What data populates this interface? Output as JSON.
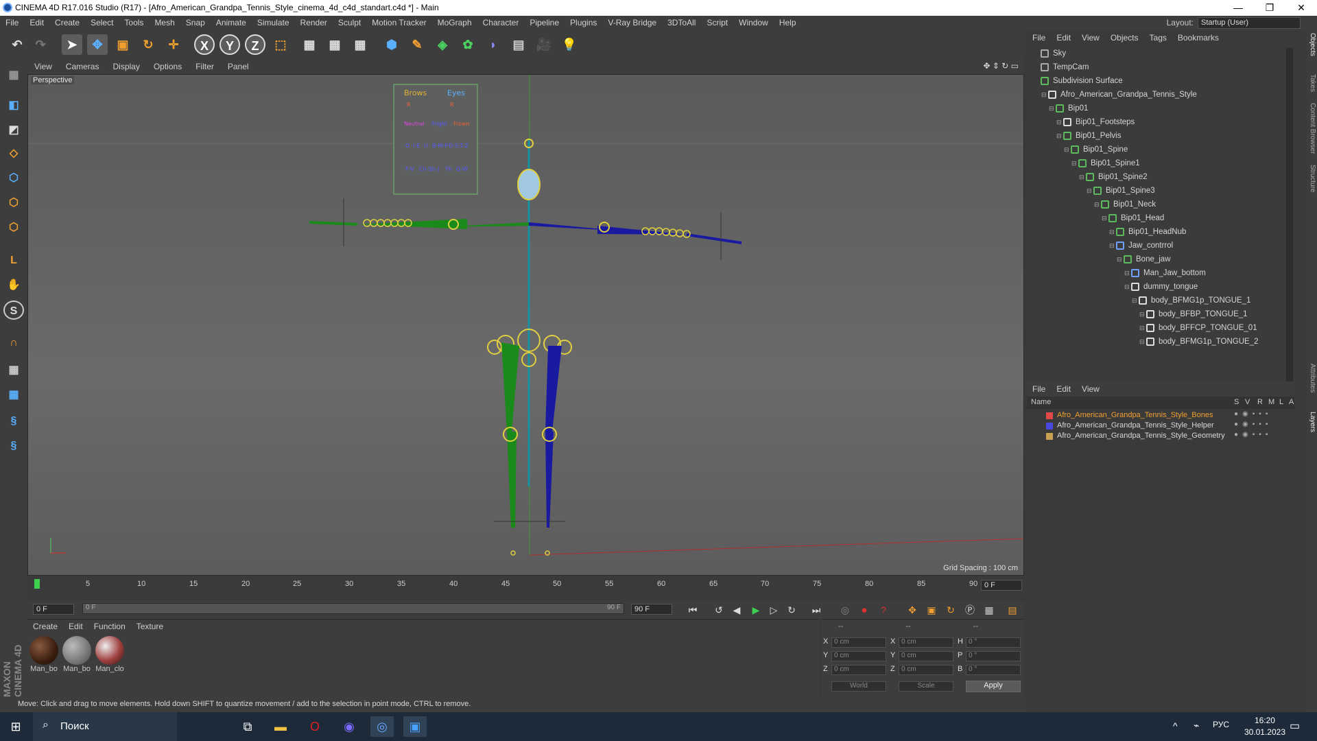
{
  "window": {
    "title": "CINEMA 4D R17.016 Studio (R17) - [Afro_American_Grandpa_Tennis_Style_cinema_4d_c4d_standart.c4d *] - Main"
  },
  "menubar": {
    "items": [
      "File",
      "Edit",
      "Create",
      "Select",
      "Tools",
      "Mesh",
      "Snap",
      "Animate",
      "Simulate",
      "Render",
      "Sculpt",
      "Motion Tracker",
      "MoGraph",
      "Character",
      "Pipeline",
      "Plugins",
      "V-Ray Bridge",
      "3DToAll",
      "Script",
      "Window",
      "Help"
    ],
    "layout_label": "Layout:",
    "layout_value": "Startup (User)"
  },
  "toolbar": {
    "axis": [
      "X",
      "Y",
      "Z"
    ]
  },
  "viewport": {
    "menu": [
      "View",
      "Cameras",
      "Display",
      "Options",
      "Filter",
      "Panel"
    ],
    "label": "Perspective",
    "grid_spacing": "Grid Spacing : 100 cm",
    "overlay_labels": [
      "Brows",
      "Eyes",
      "R",
      "R",
      "Neutral",
      "Fright",
      "Frown",
      "O",
      "I-E",
      "U",
      "B-M-P",
      "D-S-T-Z",
      "F-V",
      "Ch-Sh-J",
      "Th",
      "Q-W"
    ]
  },
  "timeline": {
    "ticks": [
      "0",
      "5",
      "10",
      "15",
      "20",
      "25",
      "30",
      "35",
      "40",
      "45",
      "50",
      "55",
      "60",
      "65",
      "70",
      "75",
      "80",
      "85",
      "90"
    ],
    "current_field": "0 F"
  },
  "playbar": {
    "start": "0 F",
    "slider_start": "0 F",
    "slider_end": "90 F",
    "end": "90 F"
  },
  "materials": {
    "menu": [
      "Create",
      "Edit",
      "Function",
      "Texture"
    ],
    "items": [
      {
        "label": "Man_bo"
      },
      {
        "label": "Man_bo"
      },
      {
        "label": "Man_clo"
      }
    ]
  },
  "coords": {
    "header": [
      "--",
      "--",
      "--"
    ],
    "rows": [
      {
        "l1": "X",
        "v1": "0 cm",
        "l2": "X",
        "v2": "0 cm",
        "l3": "H",
        "v3": "0 °"
      },
      {
        "l1": "Y",
        "v1": "0 cm",
        "l2": "Y",
        "v2": "0 cm",
        "l3": "P",
        "v3": "0 °"
      },
      {
        "l1": "Z",
        "v1": "0 cm",
        "l2": "Z",
        "v2": "0 cm",
        "l3": "B",
        "v3": "0 °"
      }
    ],
    "world": "World",
    "scale": "Scale",
    "apply": "Apply"
  },
  "status": {
    "text": "Move: Click and drag to move elements. Hold down SHIFT to quantize movement / add to the selection in point mode, CTRL to remove."
  },
  "objects": {
    "menu": [
      "File",
      "Edit",
      "View",
      "Objects",
      "Tags",
      "Bookmarks"
    ],
    "tree": [
      {
        "name": "Sky",
        "d": 0,
        "c": "#aaa"
      },
      {
        "name": "TempCam",
        "d": 0,
        "c": "#aaa"
      },
      {
        "name": "Subdivision Surface",
        "d": 0,
        "c": "#5dbb5d"
      },
      {
        "name": "Afro_American_Grandpa_Tennis_Style",
        "d": 1,
        "c": "#ddd"
      },
      {
        "name": "Bip01",
        "d": 2,
        "c": "#5dbb5d"
      },
      {
        "name": "Bip01_Footsteps",
        "d": 3,
        "c": "#ddd"
      },
      {
        "name": "Bip01_Pelvis",
        "d": 3,
        "c": "#5dbb5d"
      },
      {
        "name": "Bip01_Spine",
        "d": 4,
        "c": "#5dbb5d"
      },
      {
        "name": "Bip01_Spine1",
        "d": 5,
        "c": "#5dbb5d"
      },
      {
        "name": "Bip01_Spine2",
        "d": 6,
        "c": "#5dbb5d"
      },
      {
        "name": "Bip01_Spine3",
        "d": 7,
        "c": "#5dbb5d"
      },
      {
        "name": "Bip01_Neck",
        "d": 8,
        "c": "#5dbb5d"
      },
      {
        "name": "Bip01_Head",
        "d": 9,
        "c": "#5dbb5d"
      },
      {
        "name": "Bip01_HeadNub",
        "d": 10,
        "c": "#5dbb5d"
      },
      {
        "name": "Jaw_contrrol",
        "d": 10,
        "c": "#6fa0ff"
      },
      {
        "name": "Bone_jaw",
        "d": 11,
        "c": "#5dbb5d"
      },
      {
        "name": "Man_Jaw_bottom",
        "d": 12,
        "c": "#6fa0ff"
      },
      {
        "name": "dummy_tongue",
        "d": 12,
        "c": "#ddd"
      },
      {
        "name": "body_BFMG1p_TONGUE_1",
        "d": 13,
        "c": "#ddd"
      },
      {
        "name": "body_BFBP_TONGUE_1",
        "d": 14,
        "c": "#ddd"
      },
      {
        "name": "body_BFFCP_TONGUE_01",
        "d": 14,
        "c": "#ddd"
      },
      {
        "name": "body_BFMG1p_TONGUE_2",
        "d": 14,
        "c": "#ddd"
      }
    ]
  },
  "layers": {
    "menu": [
      "File",
      "Edit",
      "View"
    ],
    "cols": [
      "Name",
      "S",
      "V",
      "R",
      "M",
      "L",
      "A"
    ],
    "items": [
      {
        "name": "Afro_American_Grandpa_Tennis_Style_Bones",
        "color": "#e04848",
        "text": "#f0a030"
      },
      {
        "name": "Afro_American_Grandpa_Tennis_Style_Helper",
        "color": "#4848e0",
        "text": "#d8d8d8"
      },
      {
        "name": "Afro_American_Grandpa_Tennis_Style_Geometry",
        "color": "#c8a050",
        "text": "#d8d8d8"
      }
    ]
  },
  "sidetabs": [
    "Objects",
    "Takes",
    "Content Browser",
    "Structure",
    "Attributes",
    "Layers"
  ],
  "taskbar": {
    "search": "Поиск",
    "lang": "РУС",
    "time": "16:20",
    "date": "30.01.2023"
  },
  "brand": "MAXON CINEMA 4D"
}
